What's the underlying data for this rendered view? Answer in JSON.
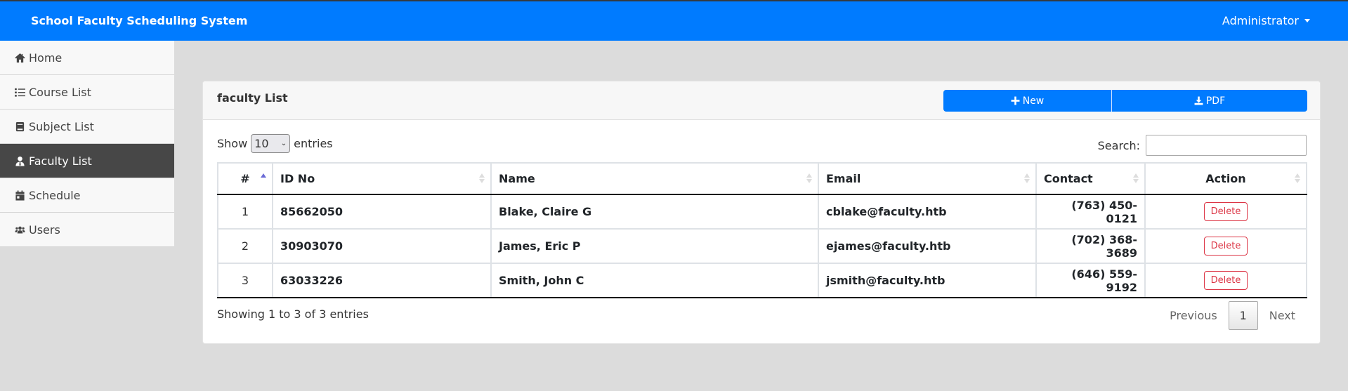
{
  "header": {
    "brand": "School Faculty Scheduling System",
    "user": "Administrator"
  },
  "sidebar": {
    "items": [
      {
        "label": "Home",
        "icon": "home-icon"
      },
      {
        "label": "Course List",
        "icon": "list-icon"
      },
      {
        "label": "Subject List",
        "icon": "book-icon"
      },
      {
        "label": "Faculty List",
        "icon": "user-tie-icon",
        "active": true
      },
      {
        "label": "Schedule",
        "icon": "calendar-icon"
      },
      {
        "label": "Users",
        "icon": "users-icon"
      }
    ]
  },
  "card": {
    "title": "faculty List",
    "new_label": "New",
    "pdf_label": "PDF"
  },
  "controls": {
    "show_label": "Show",
    "entries_value": "10",
    "entries_label": "entries",
    "search_label": "Search:",
    "search_value": ""
  },
  "table": {
    "columns": [
      "#",
      "ID No",
      "Name",
      "Email",
      "Contact",
      "Action"
    ],
    "rows": [
      {
        "num": "1",
        "id": "85662050",
        "name": "Blake, Claire G",
        "email": "cblake@faculty.htb",
        "contact": "(763) 450-0121",
        "action": "Delete"
      },
      {
        "num": "2",
        "id": "30903070",
        "name": "James, Eric P",
        "email": "ejames@faculty.htb",
        "contact": "(702) 368-3689",
        "action": "Delete"
      },
      {
        "num": "3",
        "id": "63033226",
        "name": "Smith, John C",
        "email": "jsmith@faculty.htb",
        "contact": "(646) 559-9192",
        "action": "Delete"
      }
    ]
  },
  "footer": {
    "info": "Showing 1 to 3 of 3 entries",
    "previous": "Previous",
    "page": "1",
    "next": "Next"
  },
  "colors": {
    "primary": "#007bff",
    "danger": "#dc3545",
    "sidebar_active": "#474747"
  }
}
